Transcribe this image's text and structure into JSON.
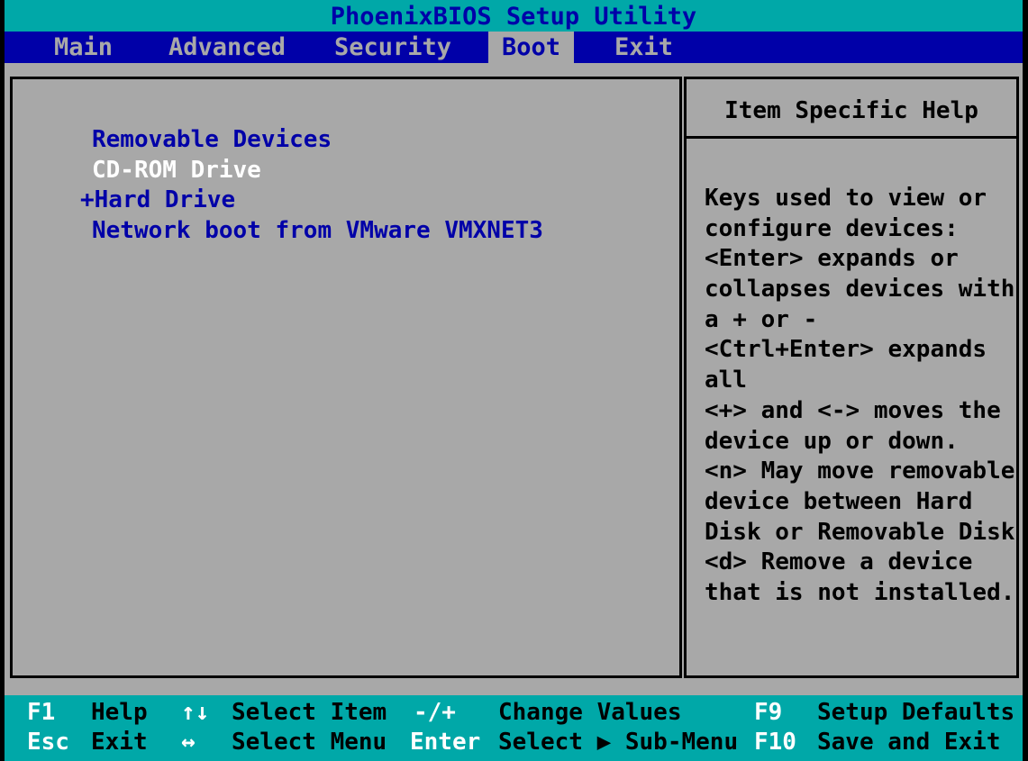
{
  "title": "PhoenixBIOS Setup Utility",
  "menu": {
    "tabs": [
      {
        "label": "Main"
      },
      {
        "label": "Advanced"
      },
      {
        "label": "Security"
      },
      {
        "label": "Boot"
      },
      {
        "label": "Exit"
      }
    ],
    "active_tab": "Boot"
  },
  "boot": {
    "items": [
      {
        "label": "Removable Devices"
      },
      {
        "label": "CD-ROM Drive"
      },
      {
        "label": "+Hard Drive"
      },
      {
        "label": "Network boot from VMware VMXNET3"
      }
    ],
    "selected_item": "CD-ROM Drive"
  },
  "help": {
    "header": "Item Specific Help",
    "lines": [
      "Keys used to view or",
      "configure devices:",
      "<Enter> expands or",
      "collapses devices with",
      "a + or -",
      "<Ctrl+Enter> expands",
      "all",
      "<+> and <-> moves the",
      "device up or down.",
      "<n> May move removable",
      "device between Hard",
      "Disk or Removable Disk",
      "<d> Remove a device",
      "that is not installed."
    ]
  },
  "status": {
    "row1": [
      {
        "key": "F1",
        "action": "Help"
      },
      {
        "key": "↑↓",
        "action": "Select Item"
      },
      {
        "key": "-/+",
        "action": "Change Values"
      },
      {
        "key": "F9",
        "action": "Setup Defaults"
      }
    ],
    "row2": [
      {
        "key": "Esc",
        "action": "Exit"
      },
      {
        "key": "↔",
        "action": "Select Menu"
      },
      {
        "key": "Enter",
        "action": "Select ▶ Sub-Menu"
      },
      {
        "key": "F10",
        "action": "Save and Exit"
      }
    ]
  },
  "colors": {
    "title_bg": "#00a8a8",
    "menu_bg": "#0000a8",
    "panel_bg": "#a8a8a8",
    "selected_text": "#ffffff",
    "item_text": "#0000a8"
  }
}
